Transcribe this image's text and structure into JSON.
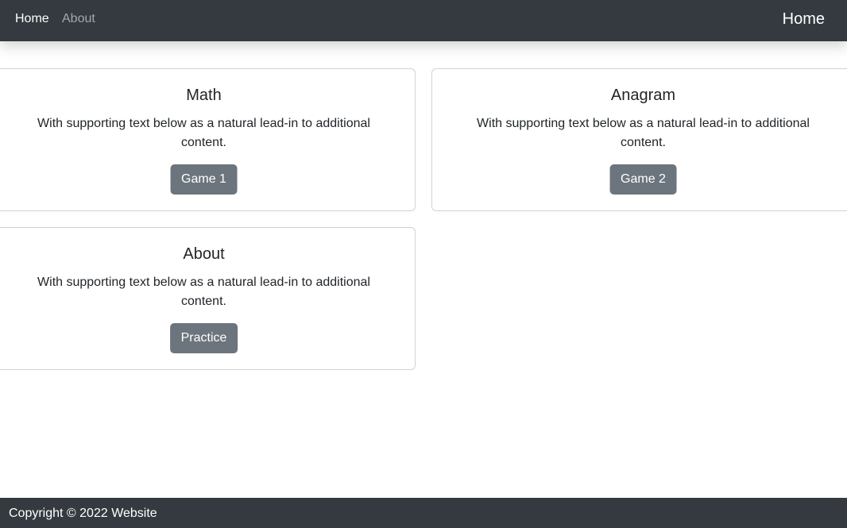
{
  "navbar": {
    "links": [
      {
        "label": "Home"
      },
      {
        "label": "About"
      }
    ],
    "brand": "Home"
  },
  "cards": [
    {
      "title": "Math",
      "text": "With supporting text below as a natural lead-in to additional content.",
      "button": "Game 1"
    },
    {
      "title": "Anagram",
      "text": "With supporting text below as a natural lead-in to additional content.",
      "button": "Game 2"
    },
    {
      "title": "About",
      "text": "With supporting text below as a natural lead-in to additional content.",
      "button": "Practice"
    }
  ],
  "footer": {
    "text": "Copyright © 2022 Website"
  },
  "colors": {
    "navbar_bg": "#343a40",
    "button_bg": "#6c757d",
    "footer_bg": "#343a40"
  }
}
